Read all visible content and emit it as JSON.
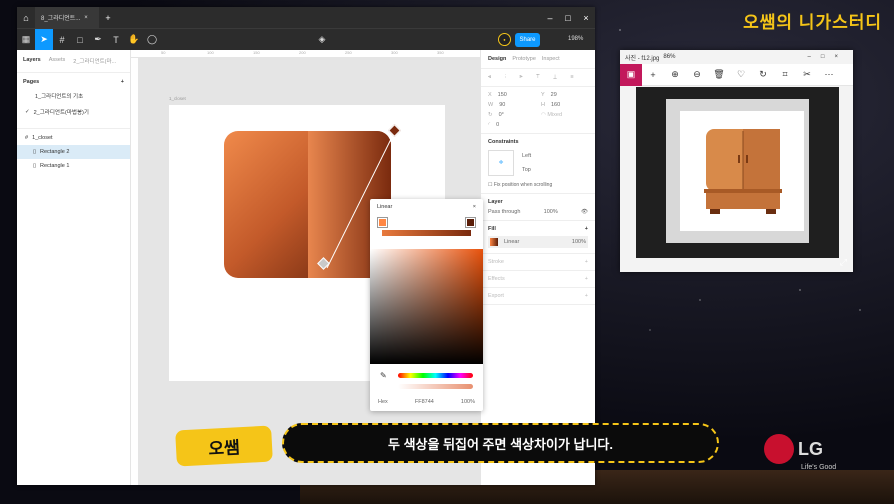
{
  "brand_title": "오쌤의 니가스터디",
  "figma": {
    "tab_label": "8_그라디언트...",
    "share_label": "Share",
    "zoom": "198%",
    "left": {
      "tabs": [
        "Layers",
        "Assets",
        "2_그라디언트(마..."
      ],
      "pages_title": "Pages",
      "pages": [
        "1_그라디언트의 기초",
        "2_그라디언트(마법봉)기"
      ],
      "layers": [
        "1_closet",
        "Rectangle 2",
        "Rectangle 1"
      ]
    },
    "ruler_ticks": [
      "50",
      "100",
      "150",
      "200",
      "250",
      "300",
      "350"
    ],
    "frame_label": "1_closet",
    "right": {
      "tabs": [
        "Design",
        "Prototype",
        "Inspect"
      ],
      "x": "150",
      "y": "29",
      "w": "90",
      "h": "160",
      "rot": "0°",
      "radius": "0",
      "constraints_title": "Constraints",
      "c_left": "Left",
      "c_top": "Top",
      "fix_label": "Fix position when scrolling",
      "layer_title": "Layer",
      "blend": "Pass through",
      "layer_opacity": "100%",
      "fill_title": "Fill",
      "fill_type": "Linear",
      "fill_opacity": "100%",
      "stroke": "Stroke",
      "effects": "Effects",
      "export": "Export"
    },
    "picker": {
      "type": "Linear",
      "hex_label": "Hex",
      "hex": "FF8744",
      "opacity": "100%"
    }
  },
  "viewer": {
    "title": "사진 - f12.jpg",
    "zoom": "86%"
  },
  "caption": "두 색상을 뒤집어 주면 색상차이가 납니다.",
  "tag": "오쌤",
  "lg": {
    "name": "LG",
    "slogan": "Life's Good"
  },
  "colors": {
    "accent": "#0d99ff",
    "gold": "#f5c518",
    "start": "#ff8744",
    "end": "#5a1d08"
  }
}
